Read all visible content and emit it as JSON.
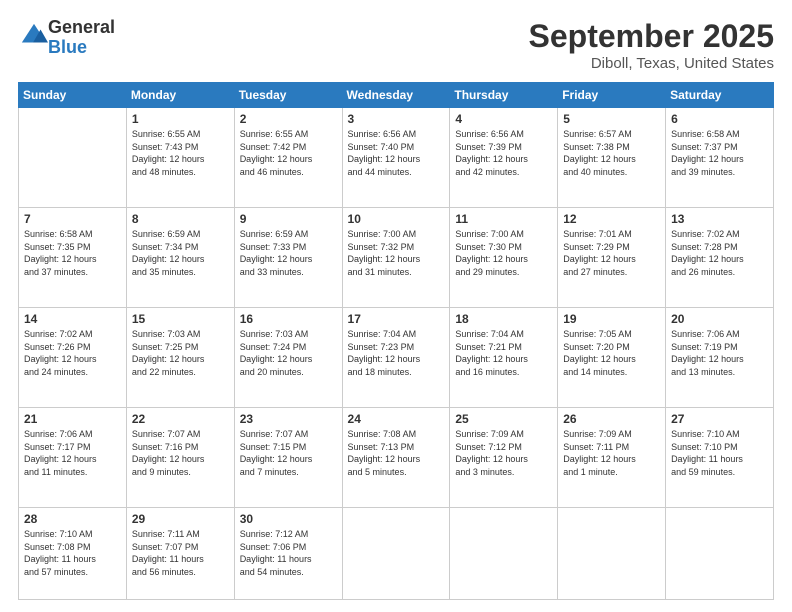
{
  "logo": {
    "general": "General",
    "blue": "Blue"
  },
  "header": {
    "month": "September 2025",
    "location": "Diboll, Texas, United States"
  },
  "weekdays": [
    "Sunday",
    "Monday",
    "Tuesday",
    "Wednesday",
    "Thursday",
    "Friday",
    "Saturday"
  ],
  "weeks": [
    [
      {
        "day": "",
        "content": ""
      },
      {
        "day": "1",
        "content": "Sunrise: 6:55 AM\nSunset: 7:43 PM\nDaylight: 12 hours\nand 48 minutes."
      },
      {
        "day": "2",
        "content": "Sunrise: 6:55 AM\nSunset: 7:42 PM\nDaylight: 12 hours\nand 46 minutes."
      },
      {
        "day": "3",
        "content": "Sunrise: 6:56 AM\nSunset: 7:40 PM\nDaylight: 12 hours\nand 44 minutes."
      },
      {
        "day": "4",
        "content": "Sunrise: 6:56 AM\nSunset: 7:39 PM\nDaylight: 12 hours\nand 42 minutes."
      },
      {
        "day": "5",
        "content": "Sunrise: 6:57 AM\nSunset: 7:38 PM\nDaylight: 12 hours\nand 40 minutes."
      },
      {
        "day": "6",
        "content": "Sunrise: 6:58 AM\nSunset: 7:37 PM\nDaylight: 12 hours\nand 39 minutes."
      }
    ],
    [
      {
        "day": "7",
        "content": "Sunrise: 6:58 AM\nSunset: 7:35 PM\nDaylight: 12 hours\nand 37 minutes."
      },
      {
        "day": "8",
        "content": "Sunrise: 6:59 AM\nSunset: 7:34 PM\nDaylight: 12 hours\nand 35 minutes."
      },
      {
        "day": "9",
        "content": "Sunrise: 6:59 AM\nSunset: 7:33 PM\nDaylight: 12 hours\nand 33 minutes."
      },
      {
        "day": "10",
        "content": "Sunrise: 7:00 AM\nSunset: 7:32 PM\nDaylight: 12 hours\nand 31 minutes."
      },
      {
        "day": "11",
        "content": "Sunrise: 7:00 AM\nSunset: 7:30 PM\nDaylight: 12 hours\nand 29 minutes."
      },
      {
        "day": "12",
        "content": "Sunrise: 7:01 AM\nSunset: 7:29 PM\nDaylight: 12 hours\nand 27 minutes."
      },
      {
        "day": "13",
        "content": "Sunrise: 7:02 AM\nSunset: 7:28 PM\nDaylight: 12 hours\nand 26 minutes."
      }
    ],
    [
      {
        "day": "14",
        "content": "Sunrise: 7:02 AM\nSunset: 7:26 PM\nDaylight: 12 hours\nand 24 minutes."
      },
      {
        "day": "15",
        "content": "Sunrise: 7:03 AM\nSunset: 7:25 PM\nDaylight: 12 hours\nand 22 minutes."
      },
      {
        "day": "16",
        "content": "Sunrise: 7:03 AM\nSunset: 7:24 PM\nDaylight: 12 hours\nand 20 minutes."
      },
      {
        "day": "17",
        "content": "Sunrise: 7:04 AM\nSunset: 7:23 PM\nDaylight: 12 hours\nand 18 minutes."
      },
      {
        "day": "18",
        "content": "Sunrise: 7:04 AM\nSunset: 7:21 PM\nDaylight: 12 hours\nand 16 minutes."
      },
      {
        "day": "19",
        "content": "Sunrise: 7:05 AM\nSunset: 7:20 PM\nDaylight: 12 hours\nand 14 minutes."
      },
      {
        "day": "20",
        "content": "Sunrise: 7:06 AM\nSunset: 7:19 PM\nDaylight: 12 hours\nand 13 minutes."
      }
    ],
    [
      {
        "day": "21",
        "content": "Sunrise: 7:06 AM\nSunset: 7:17 PM\nDaylight: 12 hours\nand 11 minutes."
      },
      {
        "day": "22",
        "content": "Sunrise: 7:07 AM\nSunset: 7:16 PM\nDaylight: 12 hours\nand 9 minutes."
      },
      {
        "day": "23",
        "content": "Sunrise: 7:07 AM\nSunset: 7:15 PM\nDaylight: 12 hours\nand 7 minutes."
      },
      {
        "day": "24",
        "content": "Sunrise: 7:08 AM\nSunset: 7:13 PM\nDaylight: 12 hours\nand 5 minutes."
      },
      {
        "day": "25",
        "content": "Sunrise: 7:09 AM\nSunset: 7:12 PM\nDaylight: 12 hours\nand 3 minutes."
      },
      {
        "day": "26",
        "content": "Sunrise: 7:09 AM\nSunset: 7:11 PM\nDaylight: 12 hours\nand 1 minute."
      },
      {
        "day": "27",
        "content": "Sunrise: 7:10 AM\nSunset: 7:10 PM\nDaylight: 11 hours\nand 59 minutes."
      }
    ],
    [
      {
        "day": "28",
        "content": "Sunrise: 7:10 AM\nSunset: 7:08 PM\nDaylight: 11 hours\nand 57 minutes."
      },
      {
        "day": "29",
        "content": "Sunrise: 7:11 AM\nSunset: 7:07 PM\nDaylight: 11 hours\nand 56 minutes."
      },
      {
        "day": "30",
        "content": "Sunrise: 7:12 AM\nSunset: 7:06 PM\nDaylight: 11 hours\nand 54 minutes."
      },
      {
        "day": "",
        "content": ""
      },
      {
        "day": "",
        "content": ""
      },
      {
        "day": "",
        "content": ""
      },
      {
        "day": "",
        "content": ""
      }
    ]
  ]
}
